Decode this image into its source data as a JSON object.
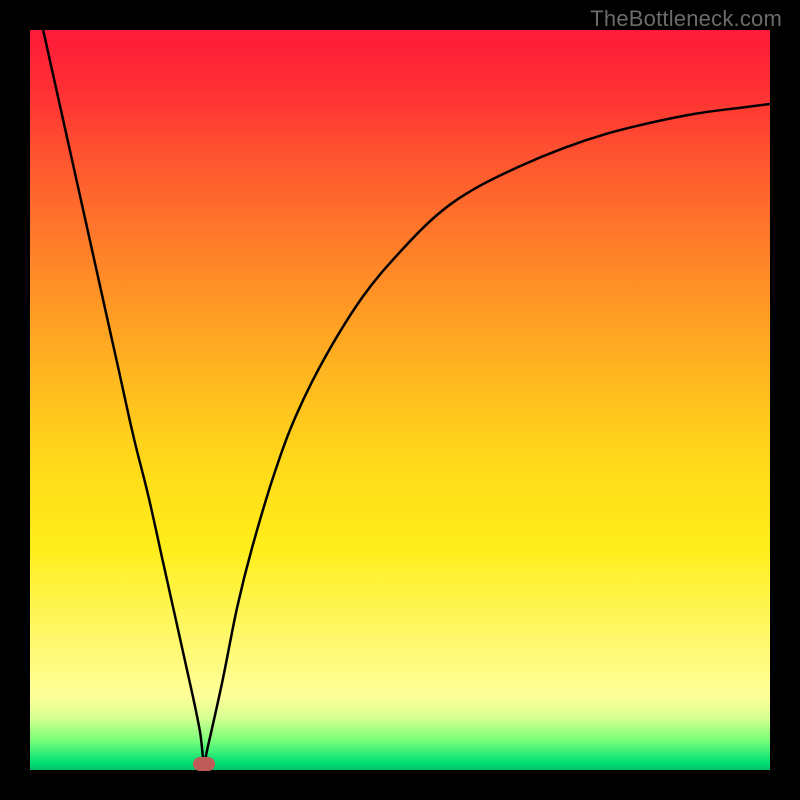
{
  "watermark": "TheBottleneck.com",
  "chart_data": {
    "type": "line",
    "title": "",
    "xlabel": "",
    "ylabel": "",
    "xlim": [
      0,
      100
    ],
    "ylim": [
      0,
      100
    ],
    "grid": false,
    "legend": null,
    "background": "rainbow-vertical-gradient (red top → green bottom)",
    "series": [
      {
        "name": "bottleneck-curve",
        "x": [
          0,
          2,
          4,
          6,
          8,
          10,
          12,
          14,
          16,
          18,
          20,
          22,
          23,
          23.5,
          24,
          26,
          28,
          30,
          33,
          36,
          40,
          45,
          50,
          55,
          60,
          66,
          72,
          78,
          84,
          90,
          96,
          100
        ],
        "values": [
          108,
          99,
          90,
          81,
          72,
          63,
          54,
          45,
          37,
          28,
          19,
          10,
          5,
          1,
          3,
          12,
          22,
          30,
          40,
          48,
          56,
          64,
          70,
          75,
          78.5,
          81.5,
          84,
          86,
          87.5,
          88.7,
          89.5,
          90
        ]
      }
    ],
    "annotations": [
      {
        "type": "marker",
        "shape": "rounded-rect",
        "x": 23.5,
        "y": 0.8,
        "color": "#be5a58"
      }
    ]
  }
}
